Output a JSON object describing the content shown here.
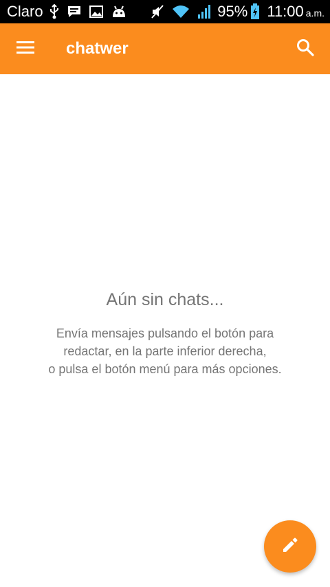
{
  "status_bar": {
    "carrier": "Claro",
    "battery_percent": "95%",
    "time": "11:00",
    "time_suffix": "a.m.",
    "icons": [
      "usb-icon",
      "message-icon",
      "image-icon",
      "android-icon",
      "mute-icon",
      "wifi-icon",
      "signal-icon",
      "battery-charging-icon"
    ]
  },
  "app_bar": {
    "title": "chatwer",
    "color": "#fb8c1e",
    "menu_icon": "menu-icon",
    "search_icon": "search-icon"
  },
  "empty_state": {
    "title": "Aún sin chats...",
    "lines": [
      "Envía mensajes pulsando el botón para",
      "redactar, en la parte inferior derecha,",
      "o pulsa el botón menú para más opciones."
    ]
  },
  "fab": {
    "icon": "pencil-icon",
    "color": "#fb8c1e"
  }
}
